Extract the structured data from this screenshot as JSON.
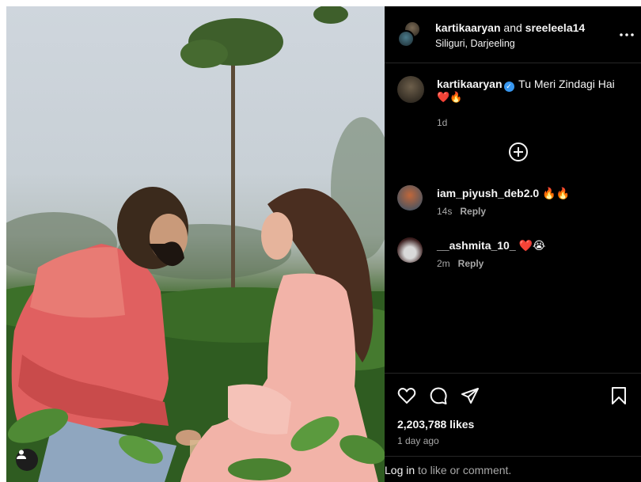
{
  "post": {
    "header": {
      "author": "kartikaaryan",
      "joiner": "and",
      "coauthor": "sreeleela14",
      "location": "Siliguri, Darjeeling"
    },
    "caption": {
      "username": "kartikaaryan",
      "text": "Tu Meri Zindagi Hai",
      "emoji": "❤️🔥",
      "time": "1d"
    },
    "comments": [
      {
        "username": "iam_piyush_deb2.0",
        "text": "🔥🔥",
        "time": "14s",
        "reply_label": "Reply"
      },
      {
        "username": "__ashmita_10_",
        "text": "❤️😭",
        "time": "2m",
        "reply_label": "Reply"
      }
    ],
    "likes": "2,203,788 likes",
    "posted": "1 day ago",
    "login": {
      "link": "Log in",
      "rest": "to like or comment."
    }
  },
  "icons": {
    "more": "more-horizontal-icon",
    "load_more": "plus-circle-icon",
    "like": "heart-icon",
    "comment": "comment-icon",
    "share": "share-icon",
    "save": "bookmark-icon",
    "tag": "user-tag-icon"
  },
  "colors": {
    "background": "#000000",
    "muted_text": "#a8a8a8",
    "verified": "#3897f0",
    "heart": "#e0245e"
  }
}
